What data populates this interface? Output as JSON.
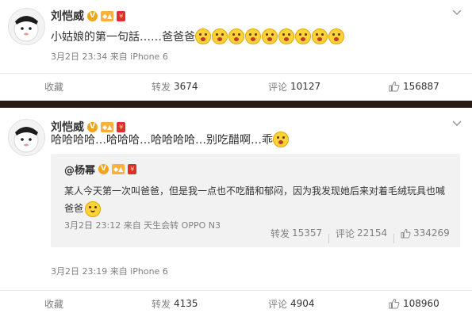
{
  "post1": {
    "author": "刘恺威",
    "text": "小姑娘的第一句話……爸爸爸",
    "emoji_count": 9,
    "meta": "3月2日 23:34 来自 iPhone 6",
    "actions": {
      "favorite_label": "收藏",
      "repost_label": "转发",
      "repost_count": "3674",
      "comment_label": "评论",
      "comment_count": "10127",
      "like_count": "156887"
    }
  },
  "post2": {
    "author": "刘恺威",
    "text": "哈哈哈哈…哈哈哈…哈哈哈哈…别吃醋啊…乖",
    "meta": "3月2日 23:19 来自 iPhone 6",
    "quote": {
      "author": "@杨幂",
      "text": "某人今天第一次叫爸爸，但是我一点也不吃醋和郁闷，因为我发现她后来对着毛绒玩具也喊爸爸",
      "meta": "3月2日 23:12 来自 天生会转 OPPO N3",
      "repost_label": "转发",
      "repost_count": "15357",
      "comment_label": "评论",
      "comment_count": "22154",
      "like_count": "334269"
    },
    "actions": {
      "favorite_label": "收藏",
      "repost_label": "转发",
      "repost_count": "4135",
      "comment_label": "评论",
      "comment_count": "4904",
      "like_count": "108960"
    }
  },
  "colors": {
    "divider": "#2a1a15",
    "verified_badge": "#f2a418",
    "quote_background": "#f2f2f2",
    "meta_text": "#808080"
  },
  "icons": [
    "chevron-down-icon",
    "verified-v-icon",
    "member-badge-icon",
    "red-envelope-icon",
    "thumbs-up-icon",
    "emoji-surprised-icon",
    "emoji-smile-icon"
  ]
}
